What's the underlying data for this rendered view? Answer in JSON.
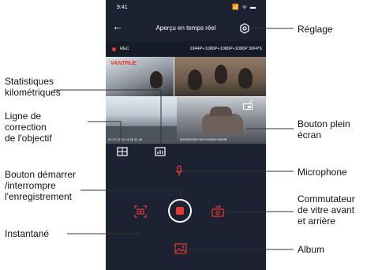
{
  "status_bar": {
    "time": "9:41",
    "system_icons": "📶 ᯤ ▬"
  },
  "nav": {
    "back_symbol": "←",
    "title": "Aperçu en temps réel"
  },
  "info_bar": {
    "rec_label": "REC",
    "resolution": "1944P+1080P+1080P+1080P 30FPS"
  },
  "video": {
    "brand": "VANTRUE",
    "stamp_left": "SL-F1 2022 14:26 30 46",
    "stamp_right": "0000005000 000 0000000 5400B"
  },
  "callouts": {
    "settings": "Réglage",
    "mileage_stats": "Statistiques\nkilométriques",
    "lens_correction": "Ligne de\ncorrection\nde l'objectif",
    "fullscreen": "Bouton plein\nécran",
    "record_toggle": "Bouton démarrer\n/interrompre\nl'enregistrement",
    "microphone": "Microphone",
    "camera_switch": "Commutateur\nde vitre avant\net arrière",
    "snapshot": "Instantané",
    "album": "Album"
  },
  "colors": {
    "accent": "#e53935",
    "screen_bg": "#1c2231",
    "info_bg": "#161b28"
  },
  "icons": {
    "back": "back-arrow-icon",
    "settings": "gear-icon",
    "lens": "grid-icon",
    "mileage": "stats-icon",
    "microphone": "microphone-icon",
    "record": "record-icon",
    "snapshot": "camera-capture-icon",
    "switch": "camera-switch-icon",
    "album": "album-icon",
    "fullscreen": "fullscreen-icon"
  }
}
